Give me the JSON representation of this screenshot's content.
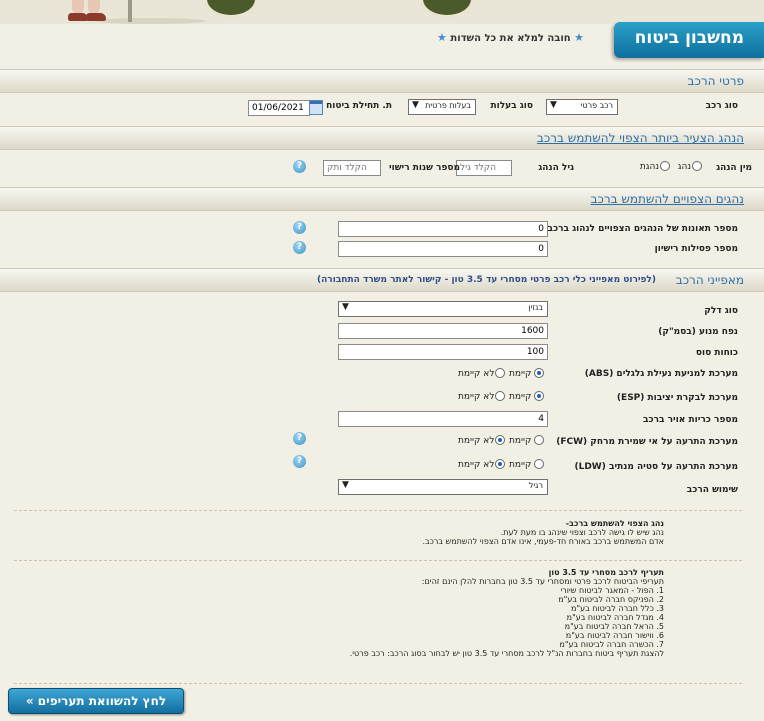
{
  "header": {
    "title": "מחשבון ביטוח",
    "required_note": "חובה למלא את כל השדות"
  },
  "sections": {
    "vehicle_details": "פרטי הרכב",
    "youngest_driver": "הנהג הצעיר ביותר הצפוי להשתמש ברכב",
    "expected_drivers": "נהגים הצפויים להשתמש ברכב",
    "vehicle_features": "מאפייני הרכב",
    "vehicle_features_note": "(לפירוט מאפייני כלי רכב פרטי מסחרי עד 3.5 טון - קישור לאתר משרד התחבורה)"
  },
  "vehicle_details": {
    "vehicle_type_label": "סוג רכב",
    "vehicle_type_value": "רכב פרטי",
    "ownership_label": "סוג בעלות",
    "ownership_value": "בעלות פרטית",
    "start_date_label": "ת. תחילת ביטוח",
    "start_date_value": "01/06/2021"
  },
  "youngest_driver": {
    "gender_label": "מין הנהג",
    "gender_male": "נהג",
    "gender_female": "נהגת",
    "age_label": "גיל הנהג",
    "age_placeholder": "הקלד גיל",
    "license_years_label": "מספר שנות רישוי",
    "license_years_placeholder": "הקלד ותק"
  },
  "expected_drivers": {
    "accidents_label": "מספר תאונות של הנהגים הצפויים לנהוג ברכב",
    "accidents_value": "0",
    "license_revocations_label": "מספר פסילות רישיון",
    "license_revocations_value": "0"
  },
  "features": {
    "fuel_label": "סוג דלק",
    "fuel_value": "בנזין",
    "engine_label": "נפח מנוע (בסמ\"ק)",
    "engine_value": "1600",
    "hp_label": "כוחות סוס",
    "hp_value": "100",
    "abs_label": "מערכת למניעת נעילת גלגלים (ABS)",
    "esp_label": "מערכת לבקרת יציבות (ESP)",
    "airbags_label": "מספר כריות אויר ברכב",
    "airbags_value": "4",
    "fcw_label": "מערכת התרעה על אי שמירת מרחק (FCW)",
    "ldw_label": "מערכת התרעה על סטיה מנתיב (LDW)",
    "usage_label": "שימוש הרכב",
    "usage_value": "רגיל",
    "exists": "קיימת",
    "not_exists": "לא קיימת"
  },
  "info1": {
    "title": "נהג הצפוי להשתמש ברכב-",
    "line1": "נהג שיש לו גישה לרכב וצפוי שינהג בו מעת לעת.",
    "line2": "אדם המשתמש ברכב באורח חד-פעמי, אינו אדם הצפוי להשתמש ברכב."
  },
  "info2": {
    "title": "תעריף לרכב מסחרי עד 3.5 טון",
    "intro": "תעריפי הביטוח לרכב פרטי ומסחרי עד 3.5 טון בחברות להלן הינם זהים:",
    "items": [
      "1. הפול - המאגר לביטוח שיורי",
      "2. הפניקס חברה לביטוח בע\"מ",
      "3. כלל חברה לביטוח בע\"מ",
      "4. מגדל חברה לביטוח בע\"מ",
      "5. הראל חברה לביטוח בע\"מ",
      "6. ווישור חברה לביטוח בע\"מ",
      "7. הכשרה חברה לביטוח בע\"מ"
    ],
    "footer": "להצגת תעריף ביטוח בחברות הנ\"ל לרכב מסחרי עד 3.5 טון יש לבחור בסוג הרכב: רכב פרטי."
  },
  "compare_button": "לחץ להשוואת תעריפים »",
  "help_glyph": "?",
  "colors": {
    "accent": "#1a86b8",
    "section_title": "#2e6fa7",
    "background": "#f2efe4"
  }
}
